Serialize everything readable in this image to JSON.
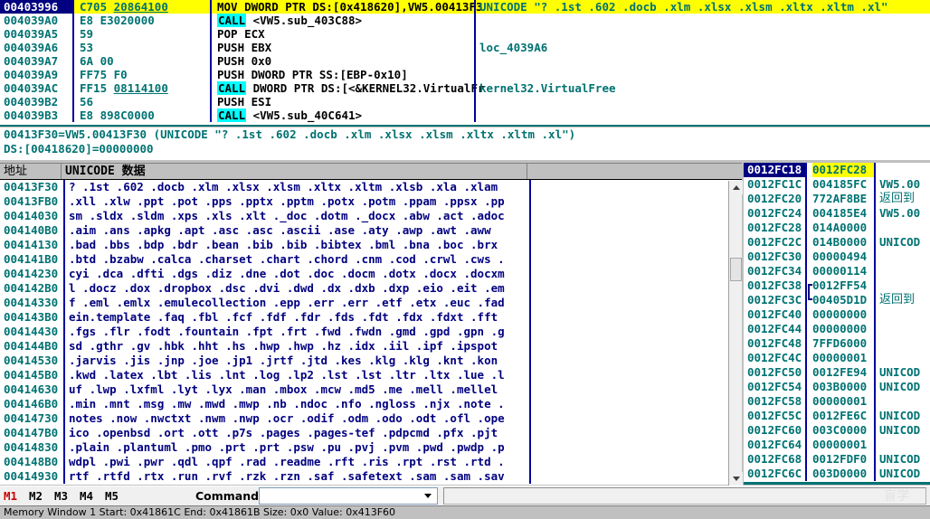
{
  "disassembly": {
    "rows": [
      {
        "addr": "00403996",
        "hex": "C705 ",
        "hex_underline": "20864100",
        "hex_tail": " ",
        "kw": "",
        "mnemonic": "MOV DWORD PTR DS:[0x418620],VW5.00413F3",
        "comment": "UNICODE \"? .1st .602 .docb .xlm .xlsx .xlsm .xltx .xltm .xl\"",
        "selected": true
      },
      {
        "addr": "004039A0",
        "hex": "E8 E3020000",
        "hex_underline": "",
        "hex_tail": "",
        "kw": "CALL",
        "mnemonic": " <VW5.sub_403C88>",
        "comment": "",
        "selected": false
      },
      {
        "addr": "004039A5",
        "hex": "59",
        "hex_underline": "",
        "hex_tail": "",
        "kw": "",
        "mnemonic": "POP ECX",
        "comment": "",
        "selected": false
      },
      {
        "addr": "004039A6",
        "hex": "53",
        "hex_underline": "",
        "hex_tail": "",
        "kw": "",
        "mnemonic": "PUSH EBX",
        "comment": "loc_4039A6",
        "selected": false
      },
      {
        "addr": "004039A7",
        "hex": "6A 00",
        "hex_underline": "",
        "hex_tail": "",
        "kw": "",
        "mnemonic": "PUSH 0x0",
        "comment": "",
        "selected": false
      },
      {
        "addr": "004039A9",
        "hex": "FF75 F0",
        "hex_underline": "",
        "hex_tail": "",
        "kw": "",
        "mnemonic": "PUSH DWORD PTR SS:[EBP-0x10]",
        "comment": "",
        "selected": false
      },
      {
        "addr": "004039AC",
        "hex": "FF15 ",
        "hex_underline": "08114100",
        "hex_tail": "",
        "kw": "CALL",
        "mnemonic": " DWORD PTR DS:[<&KERNEL32.VirtualFr",
        "comment": "kernel32.VirtualFree",
        "selected": false
      },
      {
        "addr": "004039B2",
        "hex": "56",
        "hex_underline": "",
        "hex_tail": "",
        "kw": "",
        "mnemonic": "PUSH ESI",
        "comment": "",
        "selected": false
      },
      {
        "addr": "004039B3",
        "hex": "E8 898C0000",
        "hex_underline": "",
        "hex_tail": "",
        "kw": "CALL",
        "mnemonic": " <VW5.sub_40C641>",
        "comment": "",
        "selected": false
      }
    ]
  },
  "info": {
    "line1": "00413F30=VW5.00413F30 (UNICODE \"? .1st .602 .docb .xlm .xlsx .xlsm .xltx .xltm .xl\")",
    "line2": "DS:[00418620]=00000000"
  },
  "dump": {
    "headers": {
      "address": "地址",
      "data": "UNICODE 数据",
      "blank": ""
    },
    "rows": [
      {
        "addr": "00413F30",
        "text": "? .1st .602 .docb .xlm .xlsx .xlsm .xltx .xltm .xlsb .xla .xlam"
      },
      {
        "addr": "00413FB0",
        "text": ".xll .xlw .ppt .pot .pps .pptx .pptm .potx .potm .ppam .ppsx .pp"
      },
      {
        "addr": "00414030",
        "text": "sm .sldx .sldm .xps .xls .xlt ._doc .dotm ._docx .abw .act .adoc"
      },
      {
        "addr": "004140B0",
        "text": " .aim .ans .apkg .apt .asc .asc .ascii .ase .aty .awp .awt .aww"
      },
      {
        "addr": "00414130",
        "text": ".bad .bbs .bdp .bdr .bean .bib .bib .bibtex .bml .bna .boc .brx"
      },
      {
        "addr": "004141B0",
        "text": ".btd .bzabw .calca .charset .chart .chord .cnm .cod .crwl .cws ."
      },
      {
        "addr": "00414230",
        "text": "cyi .dca .dfti .dgs .diz .dne .dot .doc .docm .dotx .docx .docxm"
      },
      {
        "addr": "004142B0",
        "text": "l .docz .dox .dropbox .dsc .dvi .dwd .dx .dxb .dxp .eio .eit .em"
      },
      {
        "addr": "00414330",
        "text": "f .eml .emlx .emulecollection .epp .err .err .etf .etx .euc .fad"
      },
      {
        "addr": "004143B0",
        "text": "ein.template .faq .fbl .fcf .fdf .fdr .fds .fdt .fdx .fdxt .fft"
      },
      {
        "addr": "00414430",
        "text": ".fgs .flr .fodt .fountain .fpt .frt .fwd .fwdn .gmd .gpd .gpn .g"
      },
      {
        "addr": "004144B0",
        "text": "sd .gthr .gv .hbk .hht .hs .hwp .hwp .hz .idx .iil .ipf .ipspot"
      },
      {
        "addr": "00414530",
        "text": ".jarvis .jis .jnp .joe .jp1 .jrtf .jtd .kes .klg .klg .knt .kon"
      },
      {
        "addr": "004145B0",
        "text": ".kwd .latex .lbt .lis .lnt .log .lp2 .lst .lst .ltr .ltx .lue .l"
      },
      {
        "addr": "00414630",
        "text": "uf .lwp .lxfml .lyt .lyx .man .mbox .mcw .md5 .me .mell .mellel"
      },
      {
        "addr": "004146B0",
        "text": ".min .mnt .msg .mw .mwd .mwp .nb .ndoc .nfo .ngloss .njx .note ."
      },
      {
        "addr": "00414730",
        "text": "notes .now .nwctxt .nwm .nwp .ocr .odif .odm .odo .odt .ofl .ope"
      },
      {
        "addr": "004147B0",
        "text": "ico .openbsd .ort .ott .p7s .pages .pages-tef .pdpcmd .pfx .pjt"
      },
      {
        "addr": "00414830",
        "text": ".plain .plantuml .pmo .prt .prt .psw .pu .pvj .pvm .pwd .pwdp .p"
      },
      {
        "addr": "004148B0",
        "text": "wdpl .pwi .pwr .qdl .qpf .rad .readme .rft .ris .rpt .rst .rtd ."
      },
      {
        "addr": "00414930",
        "text": "rtf .rtfd .rtx .run .rvf .rzk .rzn .saf .safetext .sam .sam .sav"
      }
    ]
  },
  "stack": {
    "rows": [
      {
        "addr": "0012FC18",
        "value": "0012FC28",
        "comment": "",
        "cn": false,
        "selected": true
      },
      {
        "addr": "0012FC1C",
        "value": "004185FC",
        "comment": "VW5.00",
        "cn": false,
        "selected": false
      },
      {
        "addr": "0012FC20",
        "value": "772AF8BE",
        "comment": "返回到",
        "cn": true,
        "selected": false
      },
      {
        "addr": "0012FC24",
        "value": "004185E4",
        "comment": "VW5.00",
        "cn": false,
        "selected": false
      },
      {
        "addr": "0012FC28",
        "value": "014A0000",
        "comment": "",
        "cn": false,
        "selected": false
      },
      {
        "addr": "0012FC2C",
        "value": "014B0000",
        "comment": "UNICOD",
        "cn": false,
        "selected": false
      },
      {
        "addr": "0012FC30",
        "value": "00000494",
        "comment": "",
        "cn": false,
        "selected": false
      },
      {
        "addr": "0012FC34",
        "value": "00000114",
        "comment": "",
        "cn": false,
        "selected": false
      },
      {
        "addr": "0012FC38",
        "value": "0012FF54",
        "comment": "",
        "cn": false,
        "selected": false
      },
      {
        "addr": "0012FC3C",
        "value": "00405D1D",
        "comment": "返回到",
        "cn": true,
        "selected": false
      },
      {
        "addr": "0012FC40",
        "value": "00000000",
        "comment": "",
        "cn": false,
        "selected": false
      },
      {
        "addr": "0012FC44",
        "value": "00000000",
        "comment": "",
        "cn": false,
        "selected": false
      },
      {
        "addr": "0012FC48",
        "value": "7FFD6000",
        "comment": "",
        "cn": false,
        "selected": false
      },
      {
        "addr": "0012FC4C",
        "value": "00000001",
        "comment": "",
        "cn": false,
        "selected": false
      },
      {
        "addr": "0012FC50",
        "value": "0012FE94",
        "comment": "UNICOD",
        "cn": false,
        "selected": false
      },
      {
        "addr": "0012FC54",
        "value": "003B0000",
        "comment": "UNICOD",
        "cn": false,
        "selected": false
      },
      {
        "addr": "0012FC58",
        "value": "00000001",
        "comment": "",
        "cn": false,
        "selected": false
      },
      {
        "addr": "0012FC5C",
        "value": "0012FE6C",
        "comment": "UNICOD",
        "cn": false,
        "selected": false
      },
      {
        "addr": "0012FC60",
        "value": "003C0000",
        "comment": "UNICOD",
        "cn": false,
        "selected": false
      },
      {
        "addr": "0012FC64",
        "value": "00000001",
        "comment": "",
        "cn": false,
        "selected": false
      },
      {
        "addr": "0012FC68",
        "value": "0012FDF0",
        "comment": "UNICOD",
        "cn": false,
        "selected": false
      },
      {
        "addr": "0012FC6C",
        "value": "003D0000",
        "comment": "UNICOD",
        "cn": false,
        "selected": false
      }
    ]
  },
  "toolbar": {
    "buttons": [
      {
        "label": "M1",
        "active": true
      },
      {
        "label": "M2",
        "active": false
      },
      {
        "label": "M3",
        "active": false
      },
      {
        "label": "M4",
        "active": false
      },
      {
        "label": "M5",
        "active": false
      }
    ],
    "command_label": "Command:",
    "command_value": "",
    "command_placeholder": "",
    "watermark": "盲学"
  },
  "status": {
    "text": "Memory Window 1  Start: 0x41861C  End: 0x41861B  Size: 0x0 Value: 0x413F60"
  },
  "colors": {
    "teal": "#007272",
    "navy": "#000080",
    "highlight_yellow": "#ffff00",
    "keyword_cyan": "#00ffff",
    "window_gray": "#c0c0c0"
  }
}
